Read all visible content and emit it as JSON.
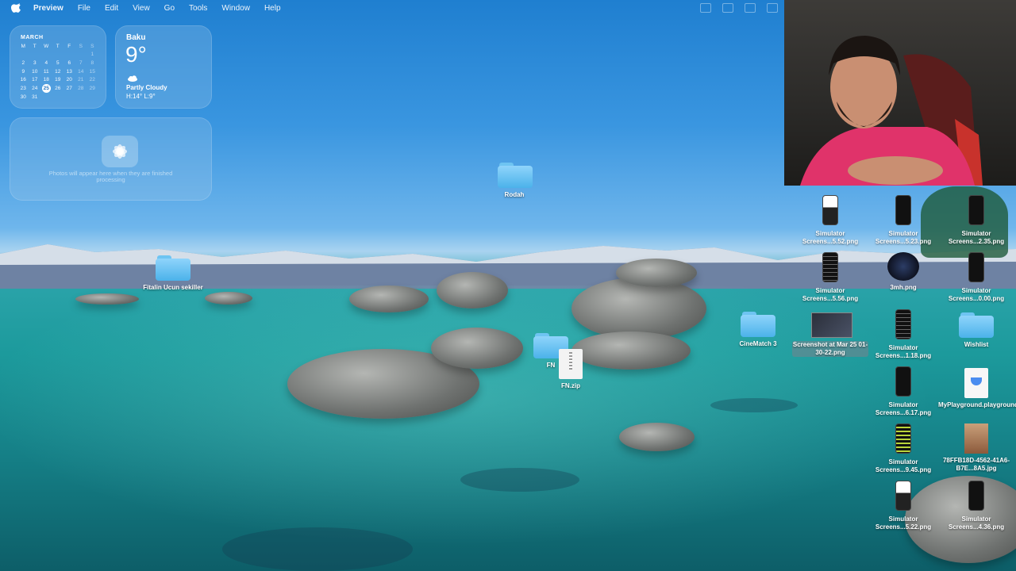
{
  "menubar": {
    "app": "Preview",
    "items": [
      "File",
      "Edit",
      "View",
      "Go",
      "Tools",
      "Window",
      "Help"
    ]
  },
  "calendar": {
    "month": "MARCH",
    "weekdays": [
      "M",
      "T",
      "W",
      "T",
      "F",
      "S",
      "S"
    ],
    "rows": [
      [
        "",
        "",
        "",
        "",
        "",
        "",
        "1"
      ],
      [
        "2",
        "3",
        "4",
        "5",
        "6",
        "7",
        "8"
      ],
      [
        "9",
        "10",
        "11",
        "12",
        "13",
        "14",
        "15"
      ],
      [
        "16",
        "17",
        "18",
        "19",
        "20",
        "21",
        "22"
      ],
      [
        "23",
        "24",
        "25",
        "26",
        "27",
        "28",
        "29"
      ],
      [
        "30",
        "31",
        "",
        "",
        "",
        "",
        ""
      ]
    ],
    "today": "25"
  },
  "weather": {
    "city": "Baku",
    "temp": "9°",
    "condition": "Partly Cloudy",
    "hilo": "H:14° L:9°"
  },
  "photos_widget": {
    "message": "Photos will appear here when they are finished processing"
  },
  "desktop_icons": {
    "rodah": "Rodah",
    "fitalin": "Fitalin Ucun sekiller",
    "fn_folder": "FN",
    "fn_zip": "FN.zip",
    "cinematch": "CineMatch 3",
    "screenshot": "Screenshot at Mar 25 01-30-22.png",
    "sim_a": "Simulator Screens...5.52.png",
    "sim_b": "Simulator Screens...5.23.png",
    "sim_c": "Simulator Screens...2.35.png",
    "sim_d": "Simulator Screens...5.56.png",
    "threemh": "3mh.png",
    "sim_e": "Simulator Screens...0.00.png",
    "sim_f": "Simulator Screens...1.18.png",
    "wishlist": "Wishlist",
    "sim_g": "Simulator Screens...6.17.png",
    "playground": "MyPlayground.playground",
    "sim_h": "Simulator Screens...9.45.png",
    "jpg": "78FFB18D-4562-41A6-B7E...8A5.jpg",
    "sim_i": "Simulator Screens...5.22.png",
    "sim_j": "Simulator Screens...4.36.png"
  }
}
